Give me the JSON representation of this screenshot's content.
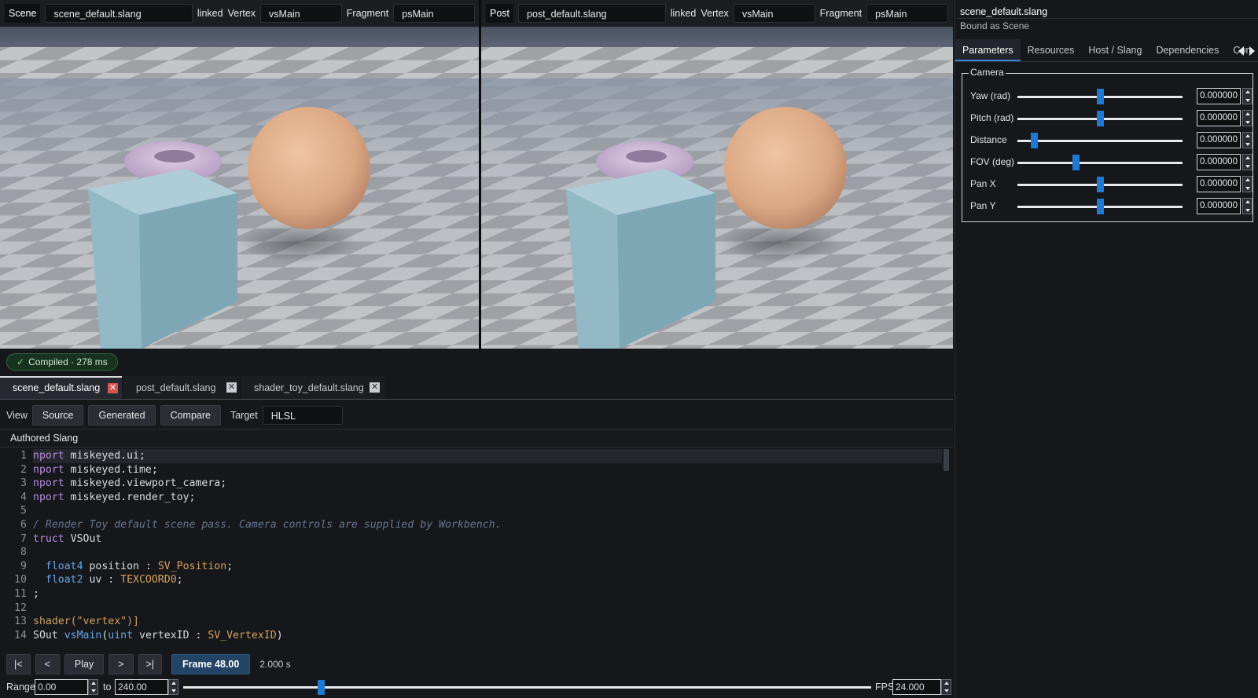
{
  "scene_bar": {
    "label": "Scene",
    "file": "scene_default.slang",
    "linked": "linked",
    "vertex_label": "Vertex",
    "vertex_entry": "vsMain",
    "fragment_label": "Fragment",
    "fragment_entry": "psMain"
  },
  "post_bar": {
    "label": "Post",
    "file": "post_default.slang",
    "linked": "linked",
    "vertex_label": "Vertex",
    "vertex_entry": "vsMain",
    "fragment_label": "Fragment",
    "fragment_entry": "psMain"
  },
  "compile_status": "Compiled · 278 ms",
  "file_tabs": [
    {
      "label": "scene_default.slang",
      "active": true
    },
    {
      "label": "post_default.slang",
      "active": false
    },
    {
      "label": "shader_toy_default.slang",
      "active": false
    }
  ],
  "view_row": {
    "view_label": "View",
    "buttons": [
      "Source",
      "Generated",
      "Compare"
    ],
    "target_label": "Target",
    "target_value": "HLSL"
  },
  "code_title": "Authored Slang",
  "code_lines": [
    "1",
    "2",
    "3",
    "4",
    "5",
    "6",
    "7",
    "8",
    "9",
    "10",
    "11",
    "12",
    "13",
    "14"
  ],
  "code": {
    "l1": "nport miskeyed.ui;",
    "l2": "nport miskeyed.time;",
    "l3": "nport miskeyed.viewport_camera;",
    "l4": "nport miskeyed.render_toy;",
    "l6": "/ Render Toy default scene pass. Camera controls are supplied by Workbench.",
    "l7": "truct VSOut",
    "l9": "  float4 position : SV_Position;",
    "l10": "  float2 uv : TEXCOORD0;",
    "l11": ";",
    "l13": "shader(\"vertex\")]",
    "l14": "SOut vsMain(uint vertexID : SV_VertexID)"
  },
  "transport": {
    "first": "|<",
    "prev": "<",
    "play": "Play",
    "next": ">",
    "last": ">|",
    "frame": "Frame 48.00",
    "time": "2.000 s"
  },
  "range": {
    "label": "Range",
    "from": "0.00",
    "to_label": "to",
    "to": "240.00",
    "fps_label": "FPS",
    "fps": "24.000",
    "playhead": 48,
    "max": 240
  },
  "right_panel": {
    "file": "scene_default.slang",
    "binding": "Bound as Scene",
    "tabs": [
      "Parameters",
      "Resources",
      "Host / Slang",
      "Dependencies",
      "Com"
    ],
    "group_title": "Camera",
    "params": [
      {
        "label": "Yaw (rad)",
        "value": "0.000000",
        "slider": 0.5
      },
      {
        "label": "Pitch (rad)",
        "value": "0.000000",
        "slider": 0.5
      },
      {
        "label": "Distance",
        "value": "0.000000",
        "slider": 0.1
      },
      {
        "label": "FOV (deg)",
        "value": "0.000000",
        "slider": 0.35
      },
      {
        "label": "Pan X",
        "value": "0.000000",
        "slider": 0.5
      },
      {
        "label": "Pan Y",
        "value": "0.000000",
        "slider": 0.5
      }
    ]
  }
}
